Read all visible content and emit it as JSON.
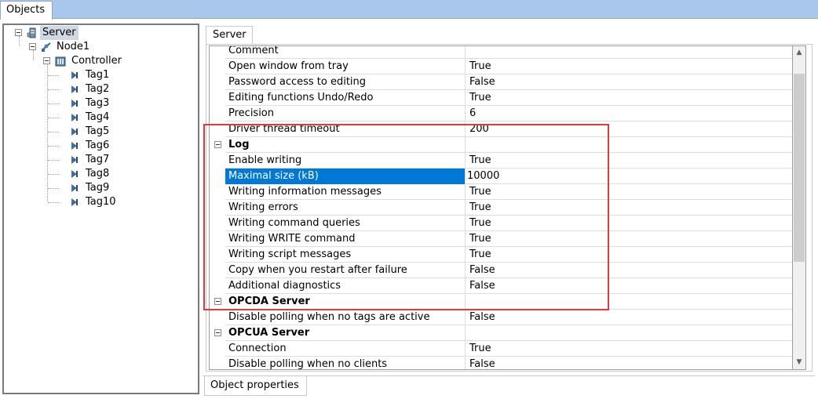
{
  "top_tab": {
    "label": "Objects"
  },
  "tree": {
    "server": "Server",
    "node": "Node1",
    "controller": "Controller",
    "tags": [
      "Tag1",
      "Tag2",
      "Tag3",
      "Tag4",
      "Tag5",
      "Tag6",
      "Tag7",
      "Tag8",
      "Tag9",
      "Tag10"
    ]
  },
  "properties_tab": {
    "label": "Server"
  },
  "properties": [
    {
      "name": "Comment",
      "value": "",
      "type": "prop"
    },
    {
      "name": "Open window from tray",
      "value": "True",
      "type": "prop"
    },
    {
      "name": "Password access to editing",
      "value": "False",
      "type": "prop"
    },
    {
      "name": "Editing functions Undo/Redo",
      "value": "True",
      "type": "prop"
    },
    {
      "name": "Precision",
      "value": "6",
      "type": "prop"
    },
    {
      "name": "Driver thread timeout",
      "value": "200",
      "type": "prop"
    },
    {
      "name": "Log",
      "value": "",
      "type": "category"
    },
    {
      "name": "Enable writing",
      "value": "True",
      "type": "prop"
    },
    {
      "name": "Maximal size (kB)",
      "value": "10000",
      "type": "prop",
      "selected": true
    },
    {
      "name": "Writing information messages",
      "value": "True",
      "type": "prop"
    },
    {
      "name": "Writing errors",
      "value": "True",
      "type": "prop"
    },
    {
      "name": "Writing command queries",
      "value": "True",
      "type": "prop"
    },
    {
      "name": "Writing WRITE command",
      "value": "True",
      "type": "prop"
    },
    {
      "name": "Writing script messages",
      "value": "True",
      "type": "prop"
    },
    {
      "name": "Copy when you restart after failure",
      "value": "False",
      "type": "prop"
    },
    {
      "name": "Additional diagnostics",
      "value": "False",
      "type": "prop"
    },
    {
      "name": "OPCDA Server",
      "value": "",
      "type": "category"
    },
    {
      "name": "Disable polling when no tags are active",
      "value": "False",
      "type": "prop"
    },
    {
      "name": "OPCUA Server",
      "value": "",
      "type": "category"
    },
    {
      "name": "Connection",
      "value": "True",
      "type": "prop"
    },
    {
      "name": "Disable polling when no clients",
      "value": "False",
      "type": "prop"
    }
  ],
  "bottom_tab": {
    "label": "Object properties"
  },
  "colors": {
    "accent": "#0078d7",
    "highlight": "#e0393e",
    "strip": "#a9c7ea"
  }
}
